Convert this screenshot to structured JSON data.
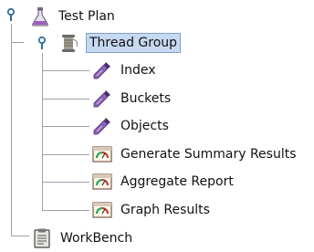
{
  "tree": {
    "root": {
      "label": "Test Plan",
      "icon": "flask-icon",
      "expanded": true
    },
    "thread_group": {
      "label": "Thread Group",
      "icon": "spool-icon",
      "expanded": true,
      "selected": true
    },
    "samplers": [
      {
        "label": "Index",
        "icon": "pipette-icon"
      },
      {
        "label": "Buckets",
        "icon": "pipette-icon"
      },
      {
        "label": "Objects",
        "icon": "pipette-icon"
      }
    ],
    "listeners": [
      {
        "label": "Generate Summary Results",
        "icon": "report-icon"
      },
      {
        "label": "Aggregate Report",
        "icon": "report-icon"
      },
      {
        "label": "Graph Results",
        "icon": "report-icon"
      }
    ],
    "workbench": {
      "label": "WorkBench",
      "icon": "clipboard-icon"
    }
  },
  "colors": {
    "selection_bg": "#c6d9f1",
    "tree_lines": "#9aa3ad",
    "toggle": "#2f6f9f"
  }
}
